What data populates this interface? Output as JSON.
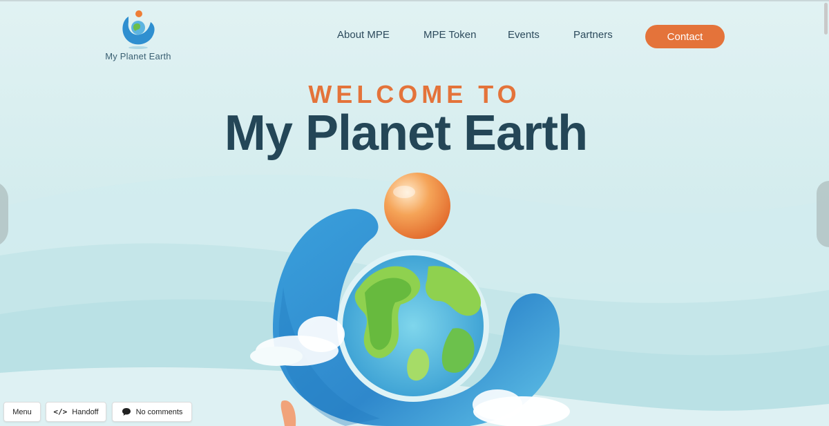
{
  "brand": {
    "name": "My Planet Earth"
  },
  "nav": {
    "items": [
      {
        "label": "About MPE"
      },
      {
        "label": "MPE Token"
      },
      {
        "label": "Events"
      },
      {
        "label": "Partners"
      }
    ],
    "contact_label": "Contact"
  },
  "hero": {
    "welcome": "WELCOME TO",
    "title": "My Planet Earth"
  },
  "toolbar": {
    "menu_label": "Menu",
    "handoff_label": "Handoff",
    "handoff_icon": "code-icon",
    "comments_label": "No comments",
    "comments_icon": "comment-icon"
  },
  "colors": {
    "accent": "#e4733a",
    "heading": "#244657",
    "nav_text": "#2c4a5c",
    "background": "#dcf0f1",
    "globe_blue": "#2f8fd0"
  }
}
